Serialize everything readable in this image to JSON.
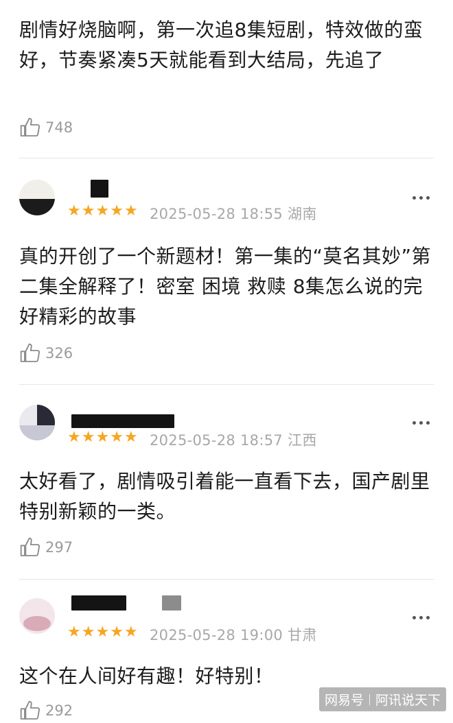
{
  "comments": [
    {
      "text": "剧情好烧脑啊，第一次追8集短剧，特效做的蛮好，节奏紧凑5天就能看到大结局，先追了",
      "likes": "748"
    },
    {
      "text": "真的开创了一个新题材！第一集的“莫名其妙”第二集全解释了！密室 困境 救赎 8集怎么说的完 好精彩的故事",
      "likes": "326",
      "rating": 5,
      "date": "2025-05-28 18:55",
      "location": "湖南"
    },
    {
      "text": "太好看了，剧情吸引着能一直看下去，国产剧里特别新颖的一类。",
      "likes": "297",
      "rating": 5,
      "date": "2025-05-28 18:57",
      "location": "江西"
    },
    {
      "text": "这个在人间好有趣！好特别！",
      "likes": "292",
      "rating": 5,
      "date": "2025-05-28 19:00",
      "location": "甘肃"
    }
  ],
  "icons": {
    "like": "thumbs-up-icon",
    "more": "more-dots-icon",
    "star": "star-icon"
  },
  "colors": {
    "star": "#f5a623",
    "meta": "#a8a8a8",
    "text": "#1c1c1c"
  },
  "watermark": {
    "source": "网易号",
    "author": "阿讯说天下"
  }
}
